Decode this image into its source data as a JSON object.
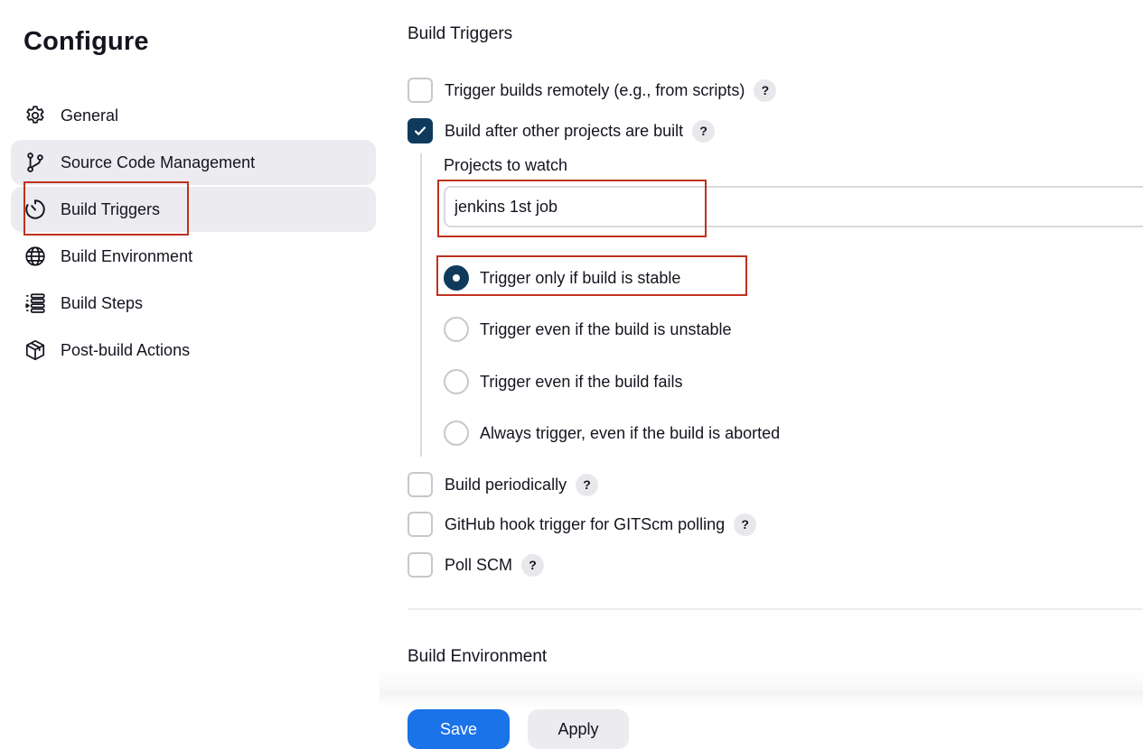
{
  "page": {
    "title": "Configure"
  },
  "sidebar": {
    "items": [
      {
        "label": "General",
        "icon": "gear-icon"
      },
      {
        "label": "Source Code Management",
        "icon": "branch-icon"
      },
      {
        "label": "Build Triggers",
        "icon": "timer-icon"
      },
      {
        "label": "Build Environment",
        "icon": "globe-icon"
      },
      {
        "label": "Build Steps",
        "icon": "list-icon"
      },
      {
        "label": "Post-build Actions",
        "icon": "package-icon"
      }
    ]
  },
  "build_triggers": {
    "title": "Build Triggers",
    "options": [
      {
        "label": "Trigger builds remotely (e.g., from scripts)",
        "checked": false,
        "help": "?"
      },
      {
        "label": "Build after other projects are built",
        "checked": true,
        "help": "?"
      }
    ],
    "projects_to_watch": {
      "label": "Projects to watch",
      "value": "jenkins 1st job"
    },
    "radios": [
      {
        "label": "Trigger only if build is stable",
        "selected": true
      },
      {
        "label": "Trigger even if the build is unstable",
        "selected": false
      },
      {
        "label": "Trigger even if the build fails",
        "selected": false
      },
      {
        "label": "Always trigger, even if the build is aborted",
        "selected": false
      }
    ],
    "more_options": [
      {
        "label": "Build periodically",
        "checked": false,
        "help": "?"
      },
      {
        "label": "GitHub hook trigger for GITScm polling",
        "checked": false,
        "help": "?"
      },
      {
        "label": "Poll SCM",
        "checked": false,
        "help": "?"
      }
    ]
  },
  "build_environment": {
    "title": "Build Environment"
  },
  "actions": {
    "save": "Save",
    "apply": "Apply"
  },
  "colors": {
    "accent": "#1a73e8",
    "checked": "#0f3a5c",
    "highlight_bg": "#ebebf0",
    "annotation": "#c0321f"
  }
}
